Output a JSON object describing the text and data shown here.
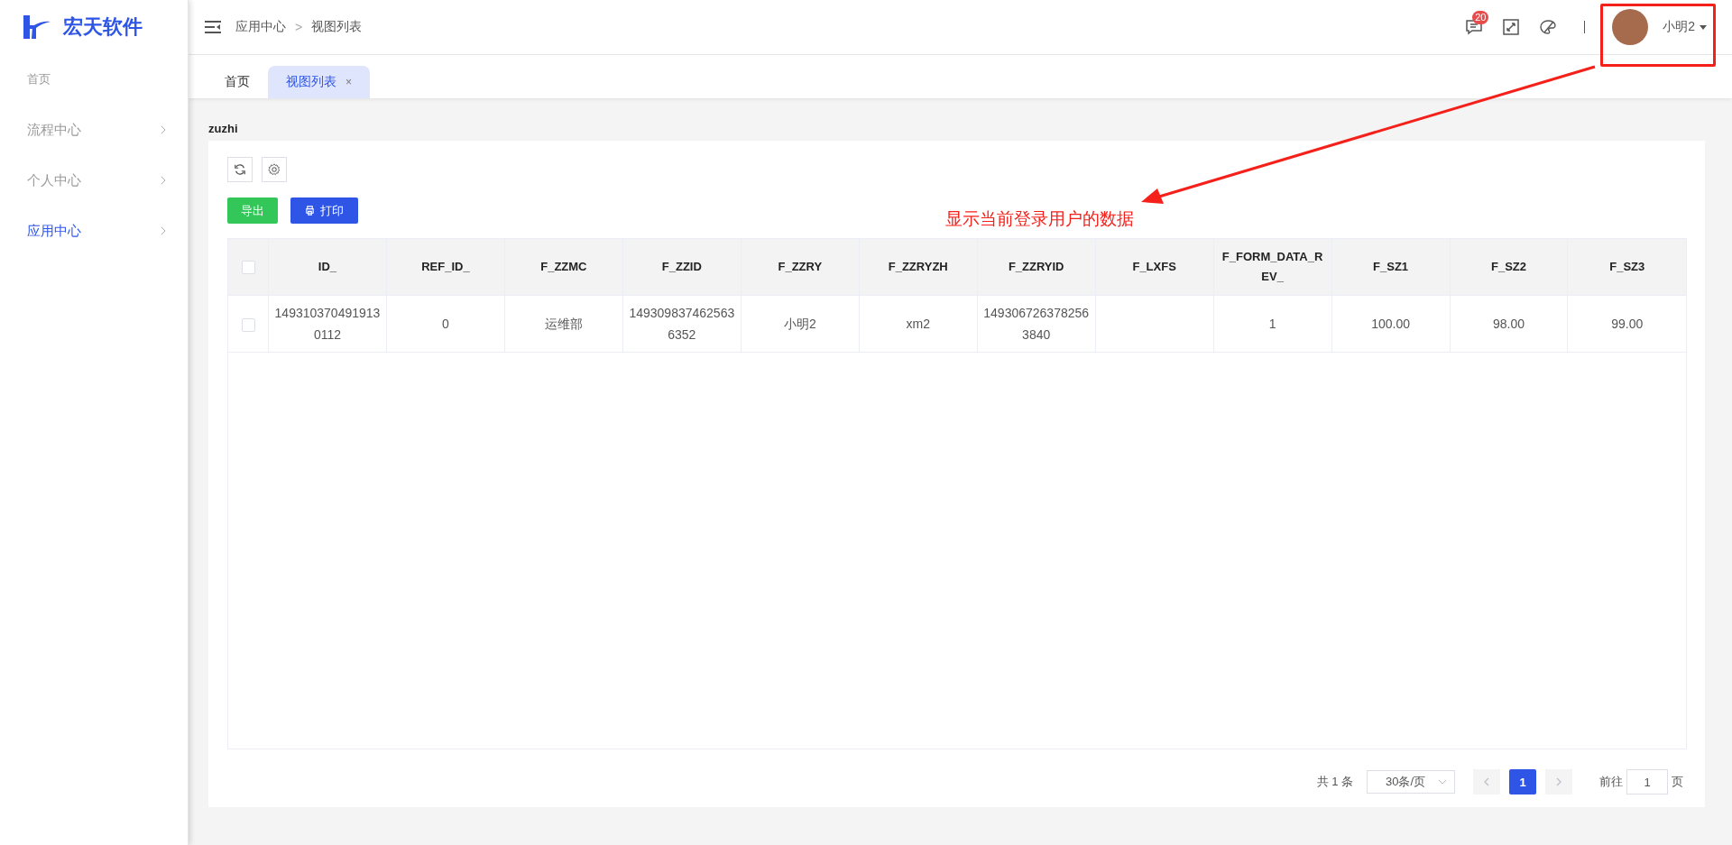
{
  "brand": {
    "name": "宏天软件"
  },
  "sidebar": {
    "items": [
      {
        "label": "首页",
        "kind": "link",
        "selected": false
      },
      {
        "label": "流程中心",
        "kind": "group",
        "selected": false
      },
      {
        "label": "个人中心",
        "kind": "group",
        "selected": false
      },
      {
        "label": "应用中心",
        "kind": "group",
        "selected": true
      }
    ]
  },
  "header": {
    "breadcrumb": [
      "应用中心",
      "视图列表"
    ],
    "breadcrumb_separator": ">",
    "message_badge": "20",
    "user": {
      "name": "小明2"
    }
  },
  "tabs": [
    {
      "label": "首页",
      "selected": false,
      "closable": false
    },
    {
      "label": "视图列表",
      "selected": true,
      "closable": true,
      "close": "×"
    }
  ],
  "page_title": "zuzhi",
  "buttons": [
    {
      "label": "导出",
      "kind": "export"
    },
    {
      "label": "打印",
      "kind": "print"
    }
  ],
  "table": {
    "select_all_checked": false,
    "columns": [
      "ID_",
      "REF_ID_",
      "F_ZZMC",
      "F_ZZID",
      "F_ZZRY",
      "F_ZZRYZH",
      "F_ZZRYID",
      "F_LXFS",
      "F_FORM_DATA_REV_",
      "F_SZ1",
      "F_SZ2",
      "F_SZ3"
    ],
    "rows": [
      {
        "checked": false,
        "cells": [
          "1493103704919130112",
          "0",
          "运维部",
          "1493098374625636352",
          "小明2",
          "xm2",
          "1493067263782563840",
          "",
          "1",
          "100.00",
          "98.00",
          "99.00"
        ]
      }
    ]
  },
  "pagination": {
    "total": "共 1 条",
    "page_size": "30条/页",
    "prev_disabled": true,
    "next_disabled": true,
    "pages": [
      {
        "label": "1",
        "selected": true
      }
    ],
    "goto_label": "前往",
    "goto_value": "1",
    "goto_suffix": "页"
  },
  "annotation": {
    "text": "显示当前登录用户的数据"
  }
}
